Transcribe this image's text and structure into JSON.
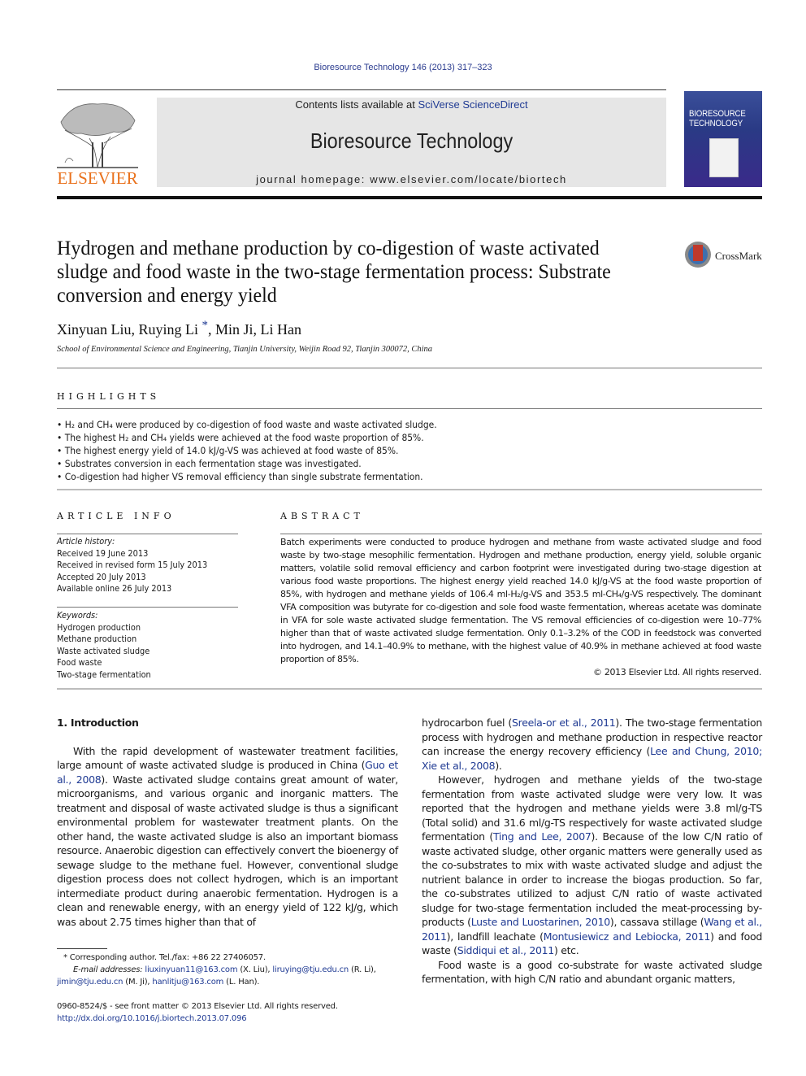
{
  "running_head": "Bioresource Technology 146 (2013) 317–323",
  "publisher": {
    "logo_word": "ELSEVIER",
    "contents_prefix": "Contents lists available at ",
    "contents_link": "SciVerse ScienceDirect",
    "journal_title": "Bioresource Technology",
    "homepage_prefix": "journal homepage: ",
    "homepage_url": "www.elsevier.com/locate/biortech",
    "cover_title_line1": "BIORESOURCE",
    "cover_title_line2": "TECHNOLOGY",
    "accent_color": "#e9711c",
    "link_color": "#1f3a93"
  },
  "crossmark": {
    "label": "CrossMark"
  },
  "article": {
    "title": "Hydrogen and methane production by co-digestion of waste activated sludge and food waste in the two-stage fermentation process: Substrate conversion and energy yield",
    "authors": [
      {
        "name": "Xinyuan Liu",
        "sep": ", "
      },
      {
        "name": "Ruying Li",
        "mark": "*",
        "sep": ", "
      },
      {
        "name": "Min Ji",
        "sep": ", "
      },
      {
        "name": "Li Han",
        "sep": ""
      }
    ],
    "affiliation": "School of Environmental Science and Engineering, Tianjin University, Weijin Road 92, Tianjin 300072, China"
  },
  "highlights": {
    "heading": "HIGHLIGHTS",
    "items": [
      "• H₂ and CH₄ were produced by co-digestion of food waste and waste activated sludge.",
      "• The highest H₂ and CH₄ yields were achieved at the food waste proportion of 85%.",
      "• The highest energy yield of 14.0 kJ/g-VS was achieved at food waste of 85%.",
      "• Substrates conversion in each fermentation stage was investigated.",
      "• Co-digestion had higher VS removal efficiency than single substrate fermentation."
    ]
  },
  "article_info": {
    "heading": "ARTICLE INFO",
    "history_label": "Article history:",
    "history": [
      "Received 19 June 2013",
      "Received in revised form 15 July 2013",
      "Accepted 20 July 2013",
      "Available online 26 July 2013"
    ],
    "keywords_label": "Keywords:",
    "keywords": [
      "Hydrogen production",
      "Methane production",
      "Waste activated sludge",
      "Food waste",
      "Two-stage fermentation"
    ]
  },
  "abstract": {
    "heading": "ABSTRACT",
    "text": "Batch experiments were conducted to produce hydrogen and methane from waste activated sludge and food waste by two-stage mesophilic fermentation. Hydrogen and methane production, energy yield, soluble organic matters, volatile solid removal efficiency and carbon footprint were investigated during two-stage digestion at various food waste proportions. The highest energy yield reached 14.0 kJ/g-VS at the food waste proportion of 85%, with hydrogen and methane yields of 106.4 ml-H₂/g-VS and 353.5 ml-CH₄/g-VS respectively. The dominant VFA composition was butyrate for co-digestion and sole food waste fermentation, whereas acetate was dominate in VFA for sole waste activated sludge fermentation. The VS removal efficiencies of co-digestion were 10–77% higher than that of waste activated sludge fermentation. Only 0.1–3.2% of the COD in feedstock was converted into hydrogen, and 14.1–40.9% to methane, with the highest value of 40.9% in methane achieved at food waste proportion of 85%.",
    "copyright": "© 2013 Elsevier Ltd. All rights reserved."
  },
  "body": {
    "section_heading": "1. Introduction",
    "left_p1_a": "With the rapid development of wastewater treatment facilities, large amount of waste activated sludge is produced in China (",
    "left_p1_cite1": "Guo et al., 2008",
    "left_p1_b": "). Waste activated sludge contains great amount of water, microorganisms, and various organic and inorganic matters. The treatment and disposal of waste activated sludge is thus a significant environmental problem for wastewater treatment plants. On the other hand, the waste activated sludge is also an important biomass resource. Anaerobic digestion can effectively convert the bioenergy of sewage sludge to the methane fuel. However, conventional sludge digestion process does not collect hydrogen, which is an important intermediate product during anaerobic fermentation. Hydrogen is a clean and renewable energy, with an energy yield of 122 kJ/g, which was about 2.75 times higher than that of",
    "right_p1_a": "hydrocarbon fuel (",
    "right_p1_cite1": "Sreela-or et al., 2011",
    "right_p1_b": "). The two-stage fermentation process with hydrogen and methane production in respective reactor can increase the energy recovery efficiency (",
    "right_p1_cite2": "Lee and Chung, 2010; Xie et al., 2008",
    "right_p1_c": ").",
    "right_p2_a": "However, hydrogen and methane yields of the two-stage fermentation from waste activated sludge were very low. It was reported that the hydrogen and methane yields were 3.8 ml/g-TS (Total solid) and 31.6 ml/g-TS respectively for waste activated sludge fermentation (",
    "right_p2_cite1": "Ting and Lee, 2007",
    "right_p2_b": "). Because of the low C/N ratio of waste activated sludge, other organic matters were generally used as the co-substrates to mix with waste activated sludge and adjust the nutrient balance in order to increase the biogas production. So far, the co-substrates utilized to adjust C/N ratio of waste activated sludge for two-stage fermentation included the meat-processing by-products (",
    "right_p2_cite2": "Luste and Luostarinen, 2010",
    "right_p2_c": "), cassava stillage (",
    "right_p2_cite3": "Wang et al., 2011",
    "right_p2_d": "), landfill leachate (",
    "right_p2_cite4": "Montusiewicz and Lebiocka, 2011",
    "right_p2_e": ") and food waste (",
    "right_p2_cite5": "Siddiqui et al., 2011",
    "right_p2_f": ") etc.",
    "right_p3": "Food waste is a good co-substrate for waste activated sludge fermentation, with high C/N ratio and abundant organic matters,"
  },
  "footnotes": {
    "corresponding": "* Corresponding author. Tel./fax: +86 22 27406057.",
    "email_label": "E-mail addresses:",
    "emails": [
      {
        "address": "liuxinyuan11@163.com",
        "who": " (X. Liu), "
      },
      {
        "address": "liruying@tju.edu.cn",
        "who": " (R. Li), "
      },
      {
        "address": "jimin@tju.edu.cn",
        "who": " (M. Ji), "
      },
      {
        "address": "hanlitju@163.com",
        "who": " (L. Han)."
      }
    ],
    "issn_line": "0960-8524/$ - see front matter © 2013 Elsevier Ltd. All rights reserved.",
    "doi": "http://dx.doi.org/10.1016/j.biortech.2013.07.096"
  }
}
